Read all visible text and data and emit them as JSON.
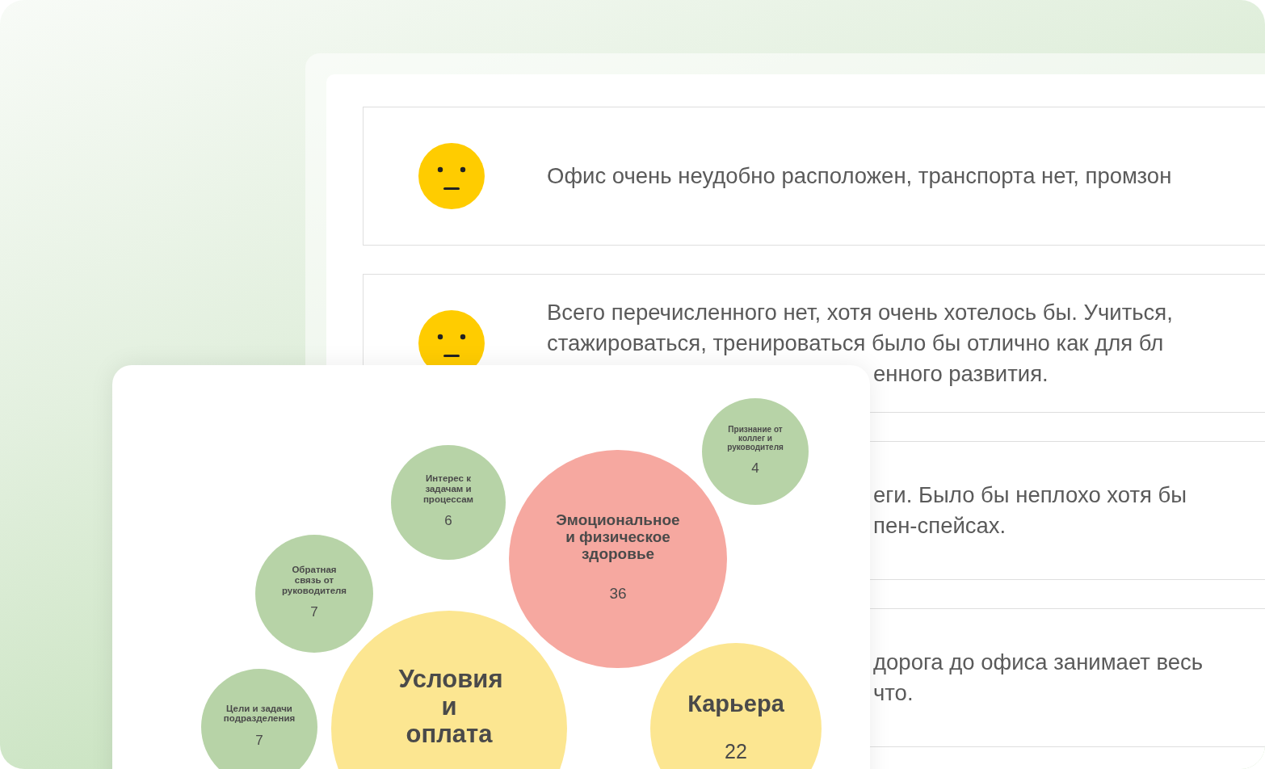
{
  "comments": [
    {
      "face": true,
      "lines": [
        {
          "text": "Офис очень неудобно расположен, транспорта нет, промзон",
          "kind": "full"
        }
      ]
    },
    {
      "face": true,
      "lines": [
        {
          "text": "Всего перечисленного нет, хотя очень хотелось бы. Учиться,",
          "kind": "full"
        },
        {
          "text": "стажироваться, тренироваться было бы отлично как для бл",
          "kind": "full"
        },
        {
          "text": "енного развития.",
          "kind": "partial"
        }
      ]
    },
    {
      "face": false,
      "lines": [
        {
          "text": "еги. Было бы неплохо хотя бы",
          "kind": "partial"
        },
        {
          "text": "пен-спейсах.",
          "kind": "partial"
        }
      ]
    },
    {
      "face": false,
      "lines": [
        {
          "text": "дорога до офиса занимает весь",
          "kind": "partial"
        },
        {
          "text": "что.",
          "kind": "partial"
        }
      ]
    }
  ],
  "bubbles": [
    {
      "label": "Признание от коллег и руководителя",
      "count": "4",
      "color": "#b7d3a7"
    },
    {
      "label": "Интерес к задачам и процессам",
      "count": "6",
      "color": "#b7d3a7"
    },
    {
      "label": "Эмоциональное и физическое здоровье",
      "count": "36",
      "color": "#f6a8a0"
    },
    {
      "label": "Обратная связь от руководителя",
      "count": "7",
      "color": "#b7d3a7"
    },
    {
      "label": "Цели и задачи подразделения",
      "count": "7",
      "color": "#b7d3a7"
    },
    {
      "label": "Условия и оплата",
      "color": "#fce691"
    },
    {
      "label": "Карьера",
      "count": "22",
      "color": "#fce691"
    }
  ]
}
